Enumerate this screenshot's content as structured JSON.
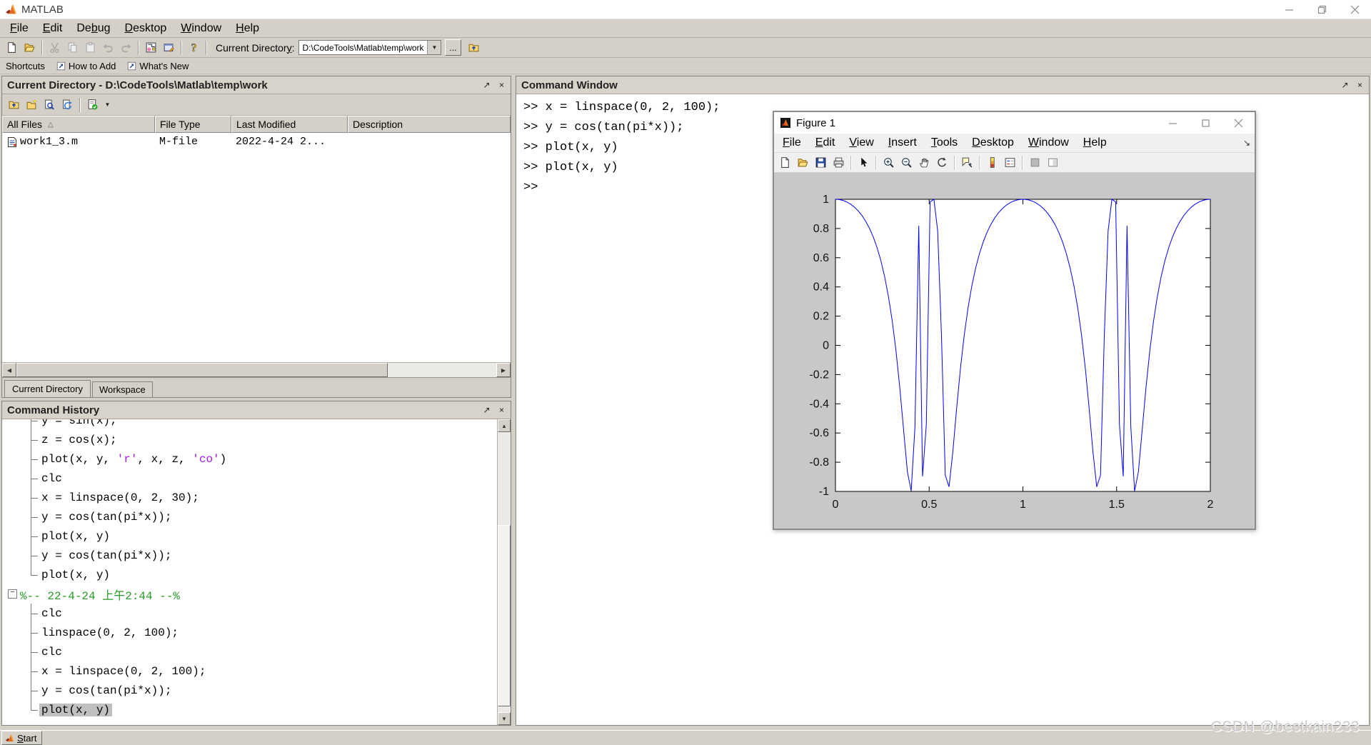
{
  "app": {
    "title": "MATLAB"
  },
  "menu_bar": {
    "items": [
      {
        "label": "File",
        "u": 0
      },
      {
        "label": "Edit",
        "u": 0
      },
      {
        "label": "Debug",
        "u": 2
      },
      {
        "label": "Desktop",
        "u": 0
      },
      {
        "label": "Window",
        "u": 0
      },
      {
        "label": "Help",
        "u": 0
      }
    ]
  },
  "main_toolbar": {
    "icons": [
      "new-file",
      "open-file",
      "cut",
      "copy",
      "paste",
      "undo",
      "redo",
      "simulink",
      "guide",
      "help"
    ],
    "current_directory_label": "Current Directory:",
    "current_directory_value": "D:\\CodeTools\\Matlab\\temp\\work",
    "browse_button": "...",
    "dropdown_icon": "▼"
  },
  "shortcuts_bar": {
    "label": "Shortcuts",
    "items": [
      {
        "label": "How to Add",
        "icon": "shortcut-arrow"
      },
      {
        "label": "What's New",
        "icon": "shortcut-arrow"
      }
    ]
  },
  "current_directory_panel": {
    "title": "Current Directory - D:\\CodeTools\\Matlab\\temp\\work",
    "undock_icon": "↗",
    "close_icon": "×",
    "dropdown_icon": "▼",
    "sort_icon": "△",
    "toolbar_icons": [
      "up-folder",
      "new-folder",
      "find-files",
      "refresh",
      "mlint-report"
    ],
    "columns": [
      "All Files",
      "File Type",
      "Last Modified",
      "Description"
    ],
    "files": [
      {
        "name": "work1_3.m",
        "type": "M-file",
        "modified": "2022-4-24 2...",
        "description": ""
      }
    ],
    "tabs": [
      {
        "label": "Current Directory",
        "active": true
      },
      {
        "label": "Workspace",
        "active": false
      }
    ],
    "scroll_left_icon": "◀",
    "scroll_right_icon": "▶"
  },
  "command_history_panel": {
    "title": "Command History",
    "undock_icon": "↗",
    "close_icon": "×",
    "collapse_icon": "−",
    "scroll_up_icon": "▲",
    "scroll_down_icon": "▼",
    "items": [
      {
        "text": "y = sin(x);",
        "branch": "mid",
        "clipped": true
      },
      {
        "text": "z = cos(x);",
        "branch": "mid"
      },
      {
        "parts": [
          {
            "t": "plot(x, y, "
          },
          {
            "t": "'r'",
            "c": "str"
          },
          {
            "t": ", x, z, "
          },
          {
            "t": "'co'",
            "c": "str"
          },
          {
            "t": ")"
          }
        ],
        "branch": "mid"
      },
      {
        "text": "clc",
        "branch": "mid"
      },
      {
        "text": "x = linspace(0, 2, 30);",
        "branch": "mid"
      },
      {
        "text": "y = cos(tan(pi*x));",
        "branch": "mid"
      },
      {
        "text": "plot(x, y)",
        "branch": "mid"
      },
      {
        "text": "y = cos(tan(pi*x));",
        "branch": "mid"
      },
      {
        "text": "plot(x, y)",
        "branch": "last"
      },
      {
        "type": "group",
        "text": "%-- 22-4-24 上午2:44 --%"
      },
      {
        "text": "clc",
        "branch": "mid"
      },
      {
        "text": "linspace(0, 2, 100);",
        "branch": "mid"
      },
      {
        "text": "clc",
        "branch": "mid"
      },
      {
        "text": "x = linspace(0, 2, 100);",
        "branch": "mid"
      },
      {
        "text": "y = cos(tan(pi*x));",
        "branch": "mid"
      },
      {
        "text": "plot(x, y)",
        "branch": "last",
        "selected": true
      }
    ]
  },
  "command_window": {
    "title": "Command Window",
    "undock_icon": "↗",
    "close_icon": "×",
    "prompt": ">>",
    "lines": [
      "x = linspace(0, 2, 100);",
      "y = cos(tan(pi*x));",
      "plot(x, y)",
      "plot(x, y)",
      ""
    ]
  },
  "figure_window": {
    "title": "Figure 1",
    "menu": {
      "items": [
        {
          "label": "File",
          "u": 0
        },
        {
          "label": "Edit",
          "u": 0
        },
        {
          "label": "View",
          "u": 0
        },
        {
          "label": "Insert",
          "u": 0
        },
        {
          "label": "Tools",
          "u": 0
        },
        {
          "label": "Desktop",
          "u": 0
        },
        {
          "label": "Window",
          "u": 0
        },
        {
          "label": "Help",
          "u": 0
        }
      ]
    },
    "dock_icon": "↘",
    "toolbar_icons": [
      "new-figure",
      "open-file",
      "save-figure",
      "print-figure",
      "edit-arrow",
      "zoom-in",
      "zoom-out",
      "pan-hand",
      "rotate-3d",
      "data-cursor",
      "insert-colorbar",
      "insert-legend",
      "hide-plot-tools",
      "show-plot-tools"
    ]
  },
  "chart_data": {
    "type": "line",
    "title": "",
    "xlabel": "",
    "ylabel": "",
    "source_commands": [
      "x = linspace(0, 2, 100);",
      "y = cos(tan(pi*x));",
      "plot(x, y)"
    ],
    "x_generation": {
      "type": "linspace",
      "start": 0,
      "stop": 2,
      "n": 100
    },
    "y_formula": "cos(tan(pi*x))",
    "xlim": [
      0,
      2
    ],
    "ylim": [
      -1,
      1
    ],
    "x_ticks": [
      {
        "v": 0,
        "label": "0"
      },
      {
        "v": 0.5,
        "label": "0.5"
      },
      {
        "v": 1,
        "label": "1"
      },
      {
        "v": 1.5,
        "label": "1.5"
      },
      {
        "v": 2,
        "label": "2"
      }
    ],
    "y_ticks": [
      {
        "v": 1,
        "label": "1"
      },
      {
        "v": 0.8,
        "label": "0.8"
      },
      {
        "v": 0.6,
        "label": "0.6"
      },
      {
        "v": 0.4,
        "label": "0.4"
      },
      {
        "v": 0.2,
        "label": "0.2"
      },
      {
        "v": 0,
        "label": "0"
      },
      {
        "v": -0.2,
        "label": "-0.2"
      },
      {
        "v": -0.4,
        "label": "-0.4"
      },
      {
        "v": -0.6,
        "label": "-0.6"
      },
      {
        "v": -0.8,
        "label": "-0.8"
      },
      {
        "v": -1,
        "label": "-1"
      }
    ],
    "line_color": "#0000ff",
    "grid": false,
    "box": true,
    "legend_position": "none"
  },
  "taskbar": {
    "start_label": "Start"
  },
  "watermark": "CSDN @bestkain233",
  "colors": {
    "chrome": "#d4d0c8",
    "figure_bg": "#c8c8c8",
    "plot_line": "#0000ff",
    "history_green": "#2a9b2a",
    "string_purple": "#a020f0",
    "selection": "#c0c0c0"
  }
}
